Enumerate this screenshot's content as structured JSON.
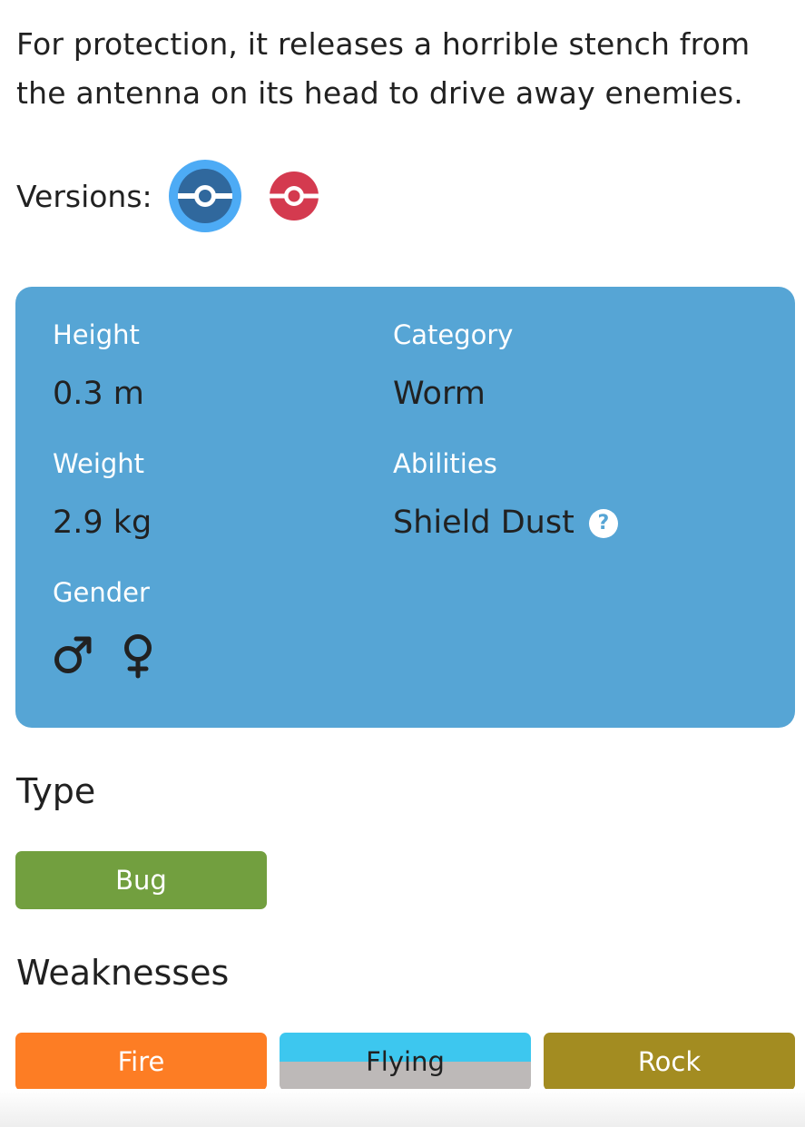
{
  "flavor_text": "For protection, it releases a horrible stench from the antenna on its head to drive away enemies.",
  "versions": {
    "label": "Versions:",
    "items": [
      {
        "name": "blue",
        "selected": true,
        "color": "#30689d",
        "ring_color": "#4dabf5"
      },
      {
        "name": "red",
        "selected": false,
        "color": "#d43a4f"
      }
    ]
  },
  "stats": {
    "height_label": "Height",
    "height_value": "0.3 m",
    "weight_label": "Weight",
    "weight_value": "2.9 kg",
    "gender_label": "Gender",
    "gender_icons": [
      "male-icon",
      "female-icon"
    ],
    "category_label": "Category",
    "category_value": "Worm",
    "abilities_label": "Abilities",
    "ability_value": "Shield Dust",
    "ability_help": "?",
    "card_color": "#56a5d5"
  },
  "type": {
    "title": "Type",
    "items": [
      {
        "label": "Bug",
        "color": "#729f3f",
        "text_color": "#ffffff"
      }
    ]
  },
  "weaknesses": {
    "title": "Weaknesses",
    "items": [
      {
        "label": "Fire",
        "color": "#fd7d24",
        "text_color": "#ffffff"
      },
      {
        "label": "Flying",
        "color_top": "#3dc7ef",
        "color_bottom": "#bdb9b8",
        "text_color": "#212121"
      },
      {
        "label": "Rock",
        "color": "#a38c21",
        "text_color": "#ffffff"
      }
    ]
  }
}
